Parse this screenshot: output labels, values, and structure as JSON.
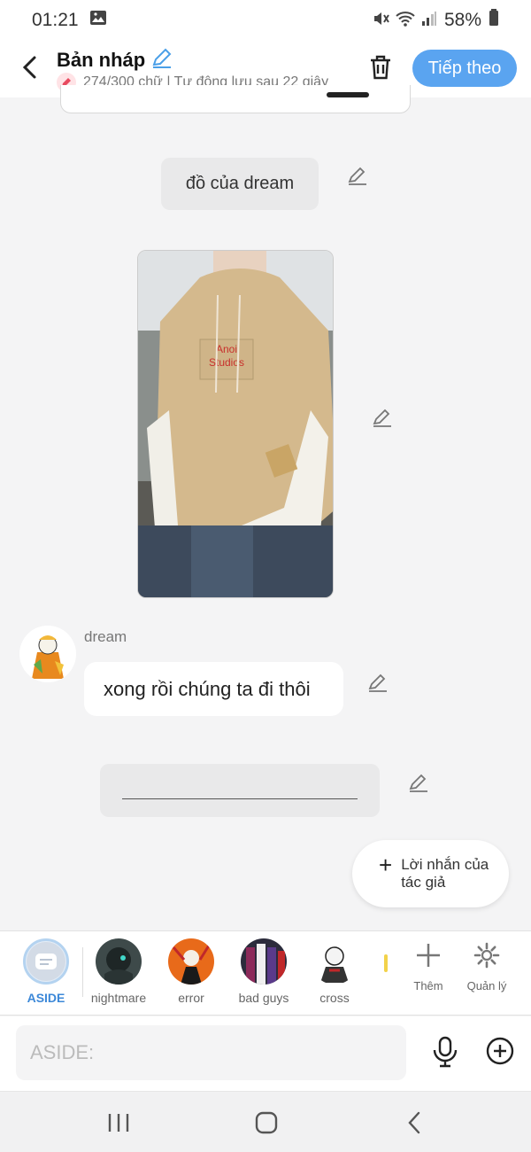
{
  "status_bar": {
    "time": "01:21",
    "battery": "58%",
    "icons": [
      "gallery-icon",
      "mute-icon",
      "wifi-icon",
      "signal-icon",
      "battery-icon"
    ]
  },
  "header": {
    "title": "Bản nháp",
    "subtitle": "274/300 chữ | Tự động lưu sau 22 giây",
    "next_label": "Tiếp theo"
  },
  "messages": [
    {
      "type": "narration",
      "text": "đồ của dream"
    },
    {
      "type": "image",
      "description_icon": "hoodie-photo"
    },
    {
      "type": "character",
      "speaker": "dream",
      "text": "xong rồi chúng ta đi thôi"
    },
    {
      "type": "narration",
      "text": "____________________________"
    }
  ],
  "author_note": {
    "label": "Lời nhắn của tác giả"
  },
  "characters": [
    {
      "name": "ASIDE",
      "selected": true
    },
    {
      "name": "nightmare"
    },
    {
      "name": "error"
    },
    {
      "name": "bad guys"
    },
    {
      "name": "cross"
    }
  ],
  "tools": {
    "add_label": "Thêm",
    "manage_label": "Quản lý"
  },
  "composer": {
    "placeholder": "ASIDE:"
  },
  "colors": {
    "accent": "#5aa4f0",
    "selected": "#3c88d8",
    "background": "#f4f4f5"
  }
}
